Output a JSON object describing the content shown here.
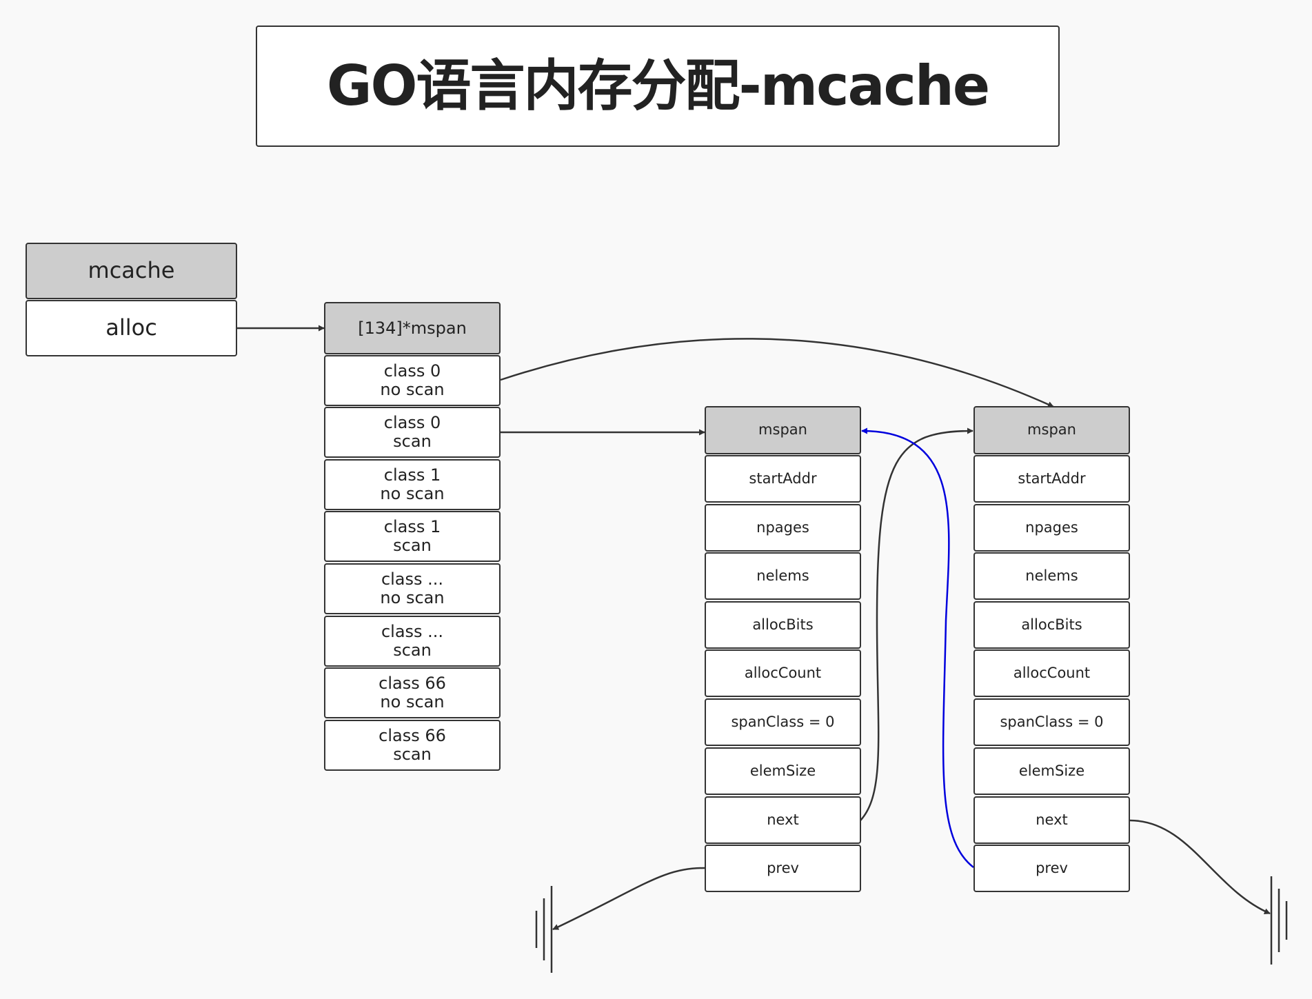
{
  "title": "GO语言内存分配-mcache",
  "mcache": {
    "header": "mcache",
    "field": "alloc"
  },
  "span_array": {
    "header": "[134]*mspan",
    "items": [
      {
        "line1": "class 0",
        "line2": "no scan"
      },
      {
        "line1": "class 0",
        "line2": "scan"
      },
      {
        "line1": "class 1",
        "line2": "no scan"
      },
      {
        "line1": "class 1",
        "line2": "scan"
      },
      {
        "line1": "class ...",
        "line2": "no scan"
      },
      {
        "line1": "class ...",
        "line2": "scan"
      },
      {
        "line1": "class 66",
        "line2": "no scan"
      },
      {
        "line1": "class 66",
        "line2": "scan"
      }
    ]
  },
  "mspans": [
    {
      "header": "mspan",
      "fields": [
        "startAddr",
        "npages",
        "nelems",
        "allocBits",
        "allocCount",
        "spanClass = 0",
        "elemSize",
        "next",
        "prev"
      ]
    },
    {
      "header": "mspan",
      "fields": [
        "startAddr",
        "npages",
        "nelems",
        "allocBits",
        "allocCount",
        "spanClass = 0",
        "elemSize",
        "next",
        "prev"
      ]
    }
  ],
  "colors": {
    "header_fill": "#cdcdcd",
    "border": "#333333",
    "prev_link": "#0000dd",
    "line": "#333333"
  }
}
